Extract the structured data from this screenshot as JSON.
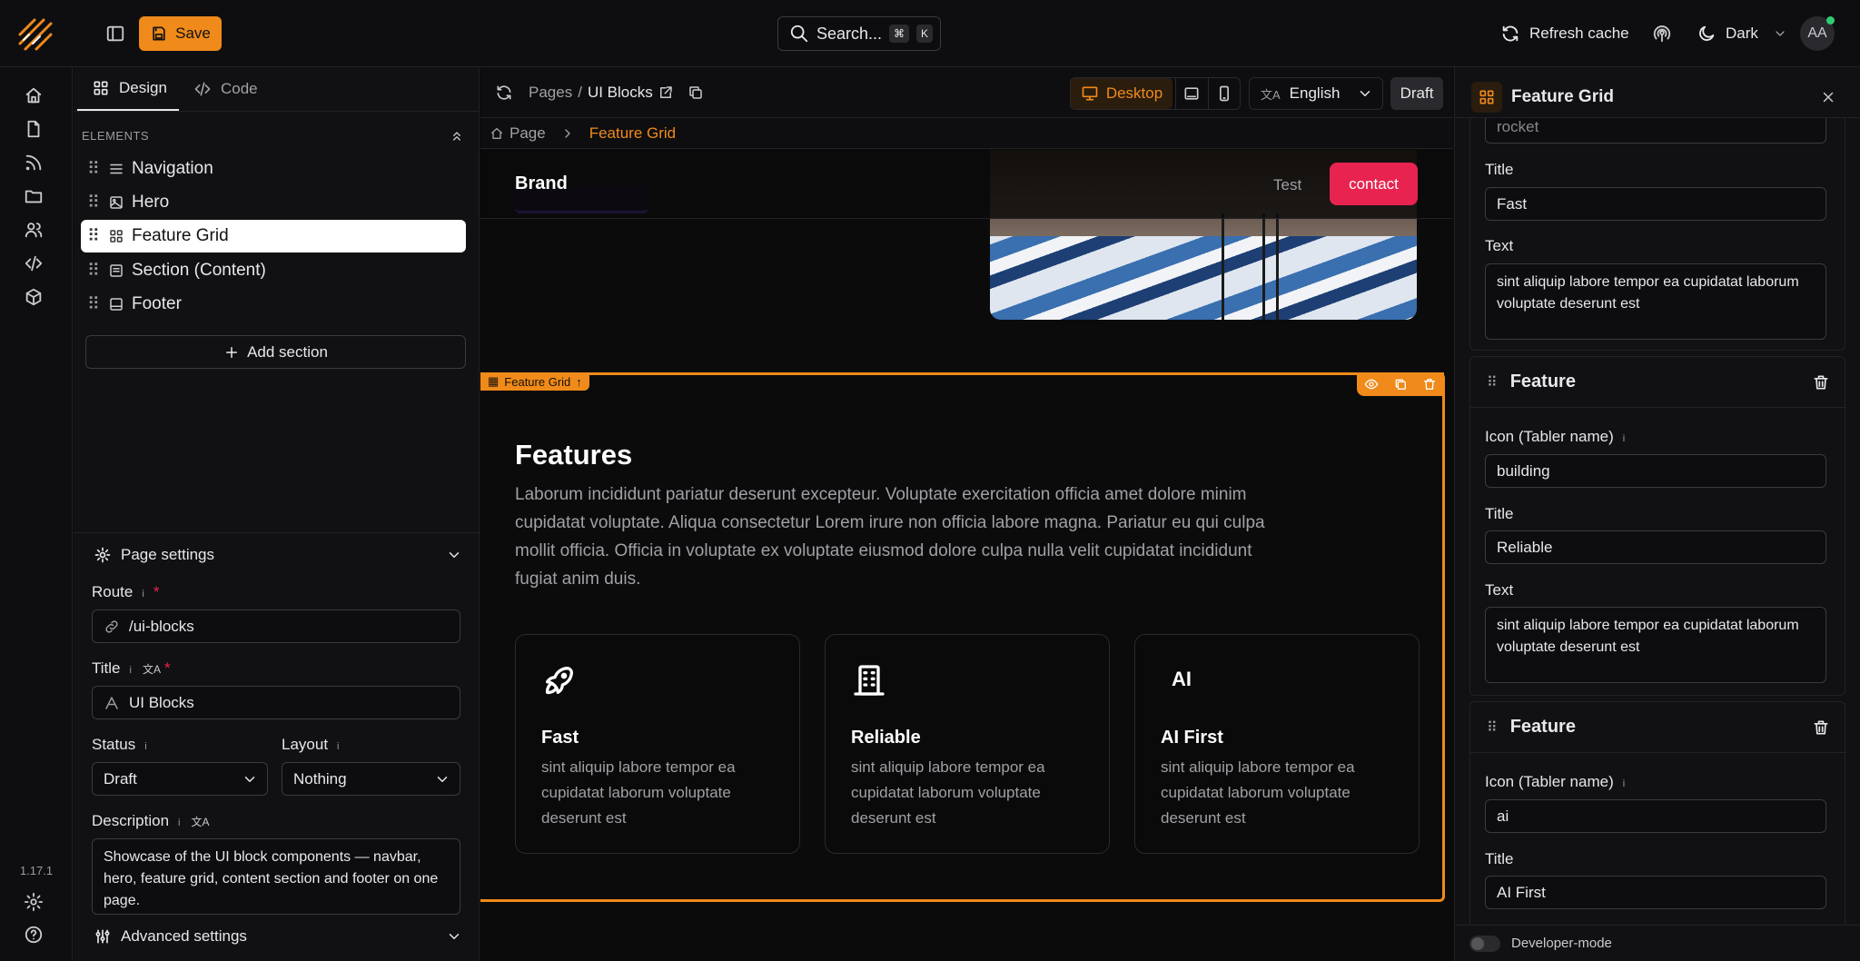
{
  "topbar": {
    "save_label": "Save",
    "search_placeholder": "Search...",
    "search_kbd_1": "⌘",
    "search_kbd_2": "K",
    "refresh_label": "Refresh cache",
    "theme_label": "Dark",
    "avatar_initials": "AA"
  },
  "rail": {
    "version": "1.17.1"
  },
  "left": {
    "tabs": [
      {
        "label": "Design"
      },
      {
        "label": "Code"
      }
    ],
    "elements_heading": "ELEMENTS",
    "elements": [
      {
        "label": "Navigation",
        "icon": "menu-icon"
      },
      {
        "label": "Hero",
        "icon": "image-icon"
      },
      {
        "label": "Feature Grid",
        "icon": "grid-icon",
        "selected": true
      },
      {
        "label": "Section (Content)",
        "icon": "section-icon"
      },
      {
        "label": "Footer",
        "icon": "footer-icon"
      }
    ],
    "add_section_label": "Add section",
    "page_settings": {
      "heading": "Page settings",
      "route_label": "Route",
      "route_value": "/ui-blocks",
      "title_label": "Title",
      "title_value": "UI Blocks",
      "status_label": "Status",
      "status_value": "Draft",
      "layout_label": "Layout",
      "layout_value": "Nothing",
      "description_label": "Description",
      "description_value": "Showcase of the UI block components — navbar, hero, feature grid, content section and footer on one page.",
      "advanced_label": "Advanced settings",
      "required_mark": "*",
      "info_mark": "i"
    }
  },
  "center": {
    "crumb_pages": "Pages",
    "crumb_sep": "/",
    "crumb_current": "UI Blocks",
    "device_label": "Desktop",
    "language_label": "English",
    "draft_label": "Draft",
    "breadcrumb_page": "Page",
    "breadcrumb_section": "Feature Grid",
    "preview": {
      "brand": "Brand",
      "nav_link": "Test",
      "contact_label": "contact",
      "section_tag": "Feature Grid",
      "section_heading": "Features",
      "section_body": "Laborum incididunt pariatur deserunt excepteur. Voluptate exercitation officia amet dolore minim cupidatat voluptate. Aliqua consectetur Lorem irure non officia labore magna. Pariatur eu qui culpa mollit officia. Officia in voluptate ex voluptate eiusmod dolore culpa nulla velit cupidatat incididunt fugiat anim duis.",
      "cards": [
        {
          "icon": "rocket-icon",
          "title": "Fast",
          "text": "sint aliquip labore tempor ea cupidatat laborum voluptate deserunt est"
        },
        {
          "icon": "building-icon",
          "title": "Reliable",
          "text": "sint aliquip labore tempor ea cupidatat laborum voluptate deserunt est"
        },
        {
          "icon": "ai-icon",
          "icon_text": "AI",
          "title": "AI First",
          "text": "sint aliquip labore tempor ea cupidatat laborum voluptate deserunt est"
        }
      ]
    }
  },
  "right": {
    "title": "Feature Grid",
    "partial_value": "rocket",
    "block1": {
      "title_label": "Title",
      "title_value": "Fast",
      "text_label": "Text",
      "text_value": "sint aliquip labore tempor ea cupidatat laborum voluptate deserunt est"
    },
    "features": [
      {
        "heading": "Feature",
        "icon_label": "Icon (Tabler name)",
        "icon_value": "building",
        "title_label": "Title",
        "title_value": "Reliable",
        "text_label": "Text",
        "text_value": "sint aliquip labore tempor ea cupidatat laborum voluptate deserunt est"
      },
      {
        "heading": "Feature",
        "icon_label": "Icon (Tabler name)",
        "icon_value": "ai",
        "title_label": "Title",
        "title_value": "AI First"
      }
    ],
    "developer_mode_label": "Developer-mode"
  },
  "colors": {
    "accent": "#f08a1a",
    "contact": "#e8234f",
    "background": "#0b0b0c"
  }
}
